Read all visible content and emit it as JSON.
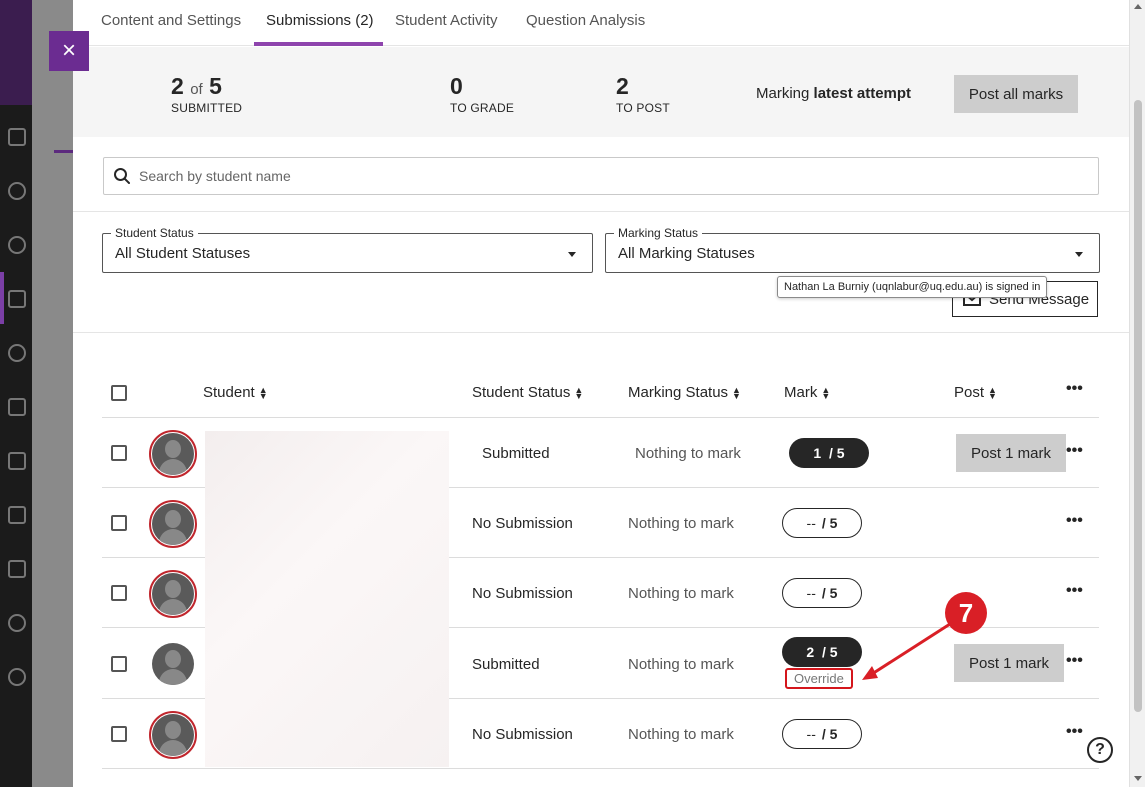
{
  "tabs": [
    {
      "label": "Content and Settings"
    },
    {
      "label": "Submissions (2)"
    },
    {
      "label": "Student Activity"
    },
    {
      "label": "Question Analysis"
    }
  ],
  "summary": {
    "submitted_count": "2",
    "submitted_of": "of",
    "submitted_total": "5",
    "submitted_label": "SUBMITTED",
    "to_grade_count": "0",
    "to_grade_label": "TO GRADE",
    "to_post_count": "2",
    "to_post_label": "TO POST",
    "marking_prefix": "Marking",
    "marking_value": "latest attempt",
    "post_all_label": "Post all marks"
  },
  "search": {
    "placeholder": "Search by student name"
  },
  "filters": {
    "student_status": {
      "legend": "Student Status",
      "value": "All Student Statuses"
    },
    "marking_status": {
      "legend": "Marking Status",
      "value": "All Marking Statuses"
    }
  },
  "send_message_label": "Send Message",
  "tooltip": "Nathan La Burniy (uqnlabur@uq.edu.au) is signed in",
  "table": {
    "headers": {
      "student": "Student",
      "student_status": "Student Status",
      "marking_status": "Marking Status",
      "mark": "Mark",
      "post": "Post"
    },
    "rows": [
      {
        "student_status": "Submitted",
        "marking_status": "Nothing to mark",
        "mark": "1",
        "total": "/ 5",
        "post": "Post 1 mark"
      },
      {
        "student_status": "No Submission",
        "marking_status": "Nothing to mark",
        "mark": "--",
        "total": "/ 5"
      },
      {
        "student_status": "No Submission",
        "marking_status": "Nothing to mark",
        "mark": "--",
        "total": "/ 5"
      },
      {
        "student_status": "Submitted",
        "marking_status": "Nothing to mark",
        "mark": "2",
        "total": "/ 5",
        "override": "Override",
        "post": "Post 1 mark"
      },
      {
        "student_status": "No Submission",
        "marking_status": "Nothing to mark",
        "mark": "--",
        "total": "/ 5"
      }
    ]
  },
  "annotation": {
    "step": "7"
  },
  "help_label": "?",
  "close_label": "×",
  "colors": {
    "accent": "#8e44ad",
    "annotation": "#d91f26"
  }
}
